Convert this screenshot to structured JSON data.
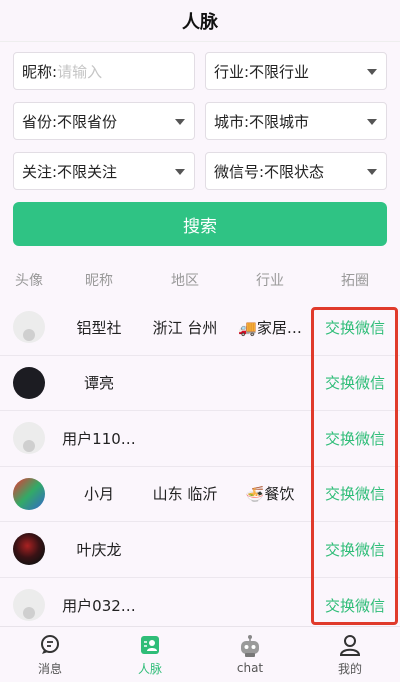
{
  "header": {
    "title": "人脉"
  },
  "filters": {
    "nickname_label": "昵称:",
    "nickname_placeholder": "请输入",
    "industry": "行业:不限行业",
    "province": "省份:不限省份",
    "city": "城市:不限城市",
    "follow": "关注:不限关注",
    "wechat": "微信号:不限状态",
    "search_button": "搜索"
  },
  "table": {
    "headers": [
      "头像",
      "昵称",
      "地区",
      "行业",
      "拓圈"
    ],
    "rows": [
      {
        "avatar": "default-avatar",
        "nickname": "铝型社",
        "region": "浙江 台州",
        "industry": "🚚家居…",
        "action": "交换微信"
      },
      {
        "avatar": "photo-avatar",
        "nickname": "谭亮",
        "region": "",
        "industry": "",
        "action": "交换微信"
      },
      {
        "avatar": "default-avatar",
        "nickname": "用户110…",
        "region": "",
        "industry": "",
        "action": "交换微信"
      },
      {
        "avatar": "photo-avatar",
        "nickname": "小月",
        "region": "山东 临沂",
        "industry": "🍜餐饮",
        "action": "交换微信"
      },
      {
        "avatar": "photo-avatar",
        "nickname": "叶庆龙",
        "region": "",
        "industry": "",
        "action": "交换微信"
      },
      {
        "avatar": "default-avatar",
        "nickname": "用户032…",
        "region": "",
        "industry": "",
        "action": "交换微信"
      }
    ]
  },
  "tabbar": {
    "items": [
      {
        "label": "消息",
        "icon": "chat-bubble-icon"
      },
      {
        "label": "人脉",
        "icon": "contacts-icon"
      },
      {
        "label": "chat",
        "icon": "robot-icon"
      },
      {
        "label": "我的",
        "icon": "user-icon"
      }
    ]
  },
  "colors": {
    "accent": "#2fc384",
    "highlight": "#e03a2b"
  }
}
